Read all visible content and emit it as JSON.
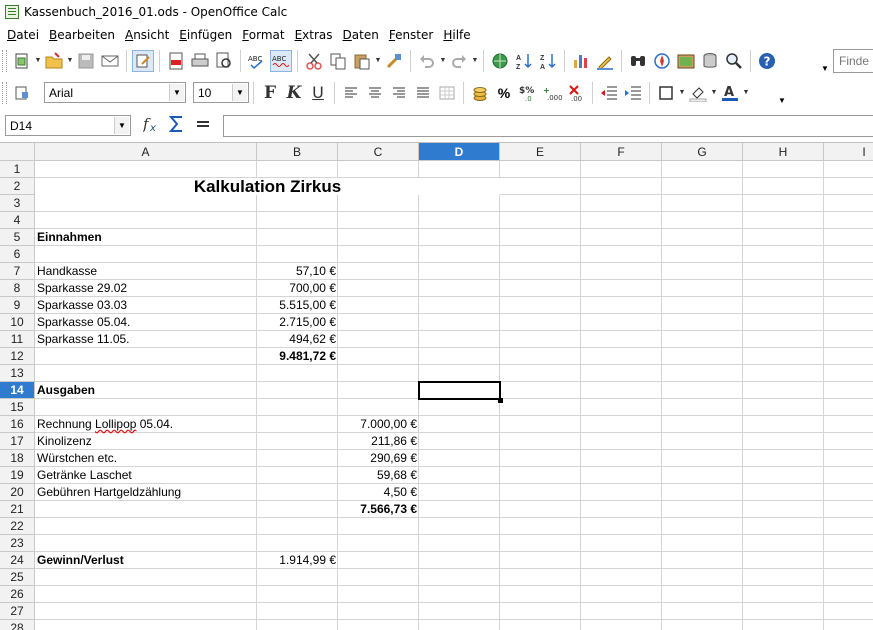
{
  "window": {
    "title": "Kassenbuch_2016_01.ods - OpenOffice Calc"
  },
  "menu": [
    "Datei",
    "Bearbeiten",
    "Ansicht",
    "Einfügen",
    "Format",
    "Extras",
    "Daten",
    "Fenster",
    "Hilfe"
  ],
  "toolbar": {
    "find_placeholder": "Finde",
    "font_name": "Arial",
    "font_size": "10",
    "bold_glyph": "F",
    "italic_glyph": "K",
    "underline_glyph": "U",
    "percent_glyph": "%"
  },
  "formula_bar": {
    "name_box": "D14",
    "formula": ""
  },
  "columns": [
    "A",
    "B",
    "C",
    "D",
    "E",
    "F",
    "G",
    "H",
    "I"
  ],
  "selected": {
    "column": "D",
    "row": 14
  },
  "rows": [
    "1",
    "2",
    "3",
    "4",
    "5",
    "6",
    "7",
    "8",
    "9",
    "10",
    "11",
    "12",
    "13",
    "14",
    "15",
    "16",
    "17",
    "18",
    "19",
    "20",
    "21",
    "22",
    "23",
    "24",
    "25",
    "26",
    "27",
    "28"
  ],
  "sheet": {
    "title": "Kalkulation Zirkus",
    "income_header": "Einnahmen",
    "income": [
      {
        "label": "Handkasse",
        "amount": "57,10 €"
      },
      {
        "label": "Sparkasse 29.02",
        "amount": "700,00 €"
      },
      {
        "label": "Sparkasse 03.03",
        "amount": "5.515,00 €"
      },
      {
        "label": "Sparkasse 05.04.",
        "amount": "2.715,00 €"
      },
      {
        "label": "Sparkasse 11.05.",
        "amount": "494,62 €"
      }
    ],
    "income_total": "9.481,72 €",
    "expense_header": "Ausgaben",
    "expenses": [
      {
        "label": "Rechnung Lollipop 05.04.",
        "amount": "7.000,00 €"
      },
      {
        "label": "Kinolizenz",
        "amount": "211,86 €"
      },
      {
        "label": "Würstchen etc.",
        "amount": "290,69 €"
      },
      {
        "label": "Getränke Laschet",
        "amount": "59,68 €"
      },
      {
        "label": "Gebühren Hartgeldzählung",
        "amount": "4,50 €"
      }
    ],
    "expense_total": "7.566,73 €",
    "result_label": "Gewinn/Verlust",
    "result_value": "1.914,99 €"
  }
}
